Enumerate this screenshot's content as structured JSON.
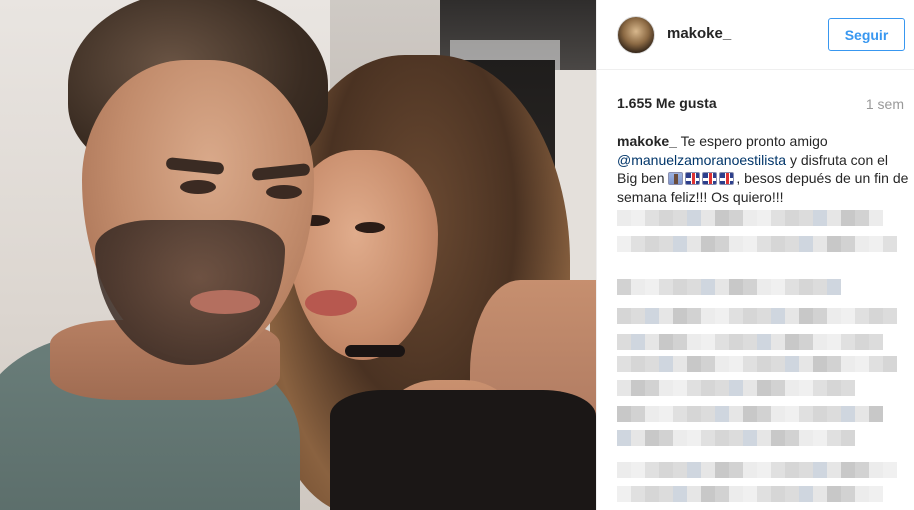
{
  "post": {
    "author": "makoke_",
    "follow_label": "Seguir",
    "likes": "1.655 Me gusta",
    "time": "1 sem",
    "caption": {
      "user": "makoke_",
      "text1": "Te espero pronto amigo",
      "mention": "@manuelzamoranoestilista",
      "text2": "y disfruta con el Big ben",
      "text3": ", besos depués de un fin de semana feliz!!! Os quiero!!!"
    }
  },
  "icons": {
    "flags": [
      "tower-emoji-icon",
      "uk-flag-icon",
      "uk-flag-icon",
      "uk-flag-icon"
    ]
  },
  "colors": {
    "accent": "#3897f0",
    "mention": "#003569",
    "muted": "#999999"
  }
}
